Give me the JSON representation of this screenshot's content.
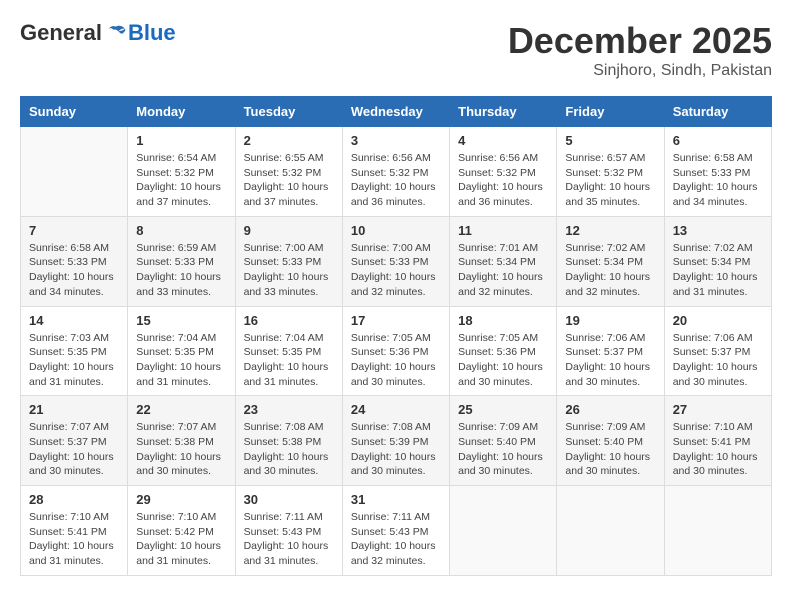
{
  "logo": {
    "general": "General",
    "blue": "Blue"
  },
  "header": {
    "month": "December 2025",
    "location": "Sinjhoro, Sindh, Pakistan"
  },
  "weekdays": [
    "Sunday",
    "Monday",
    "Tuesday",
    "Wednesday",
    "Thursday",
    "Friday",
    "Saturday"
  ],
  "weeks": [
    [
      {
        "day": "",
        "info": ""
      },
      {
        "day": "1",
        "info": "Sunrise: 6:54 AM\nSunset: 5:32 PM\nDaylight: 10 hours\nand 37 minutes."
      },
      {
        "day": "2",
        "info": "Sunrise: 6:55 AM\nSunset: 5:32 PM\nDaylight: 10 hours\nand 37 minutes."
      },
      {
        "day": "3",
        "info": "Sunrise: 6:56 AM\nSunset: 5:32 PM\nDaylight: 10 hours\nand 36 minutes."
      },
      {
        "day": "4",
        "info": "Sunrise: 6:56 AM\nSunset: 5:32 PM\nDaylight: 10 hours\nand 36 minutes."
      },
      {
        "day": "5",
        "info": "Sunrise: 6:57 AM\nSunset: 5:32 PM\nDaylight: 10 hours\nand 35 minutes."
      },
      {
        "day": "6",
        "info": "Sunrise: 6:58 AM\nSunset: 5:33 PM\nDaylight: 10 hours\nand 34 minutes."
      }
    ],
    [
      {
        "day": "7",
        "info": "Sunrise: 6:58 AM\nSunset: 5:33 PM\nDaylight: 10 hours\nand 34 minutes."
      },
      {
        "day": "8",
        "info": "Sunrise: 6:59 AM\nSunset: 5:33 PM\nDaylight: 10 hours\nand 33 minutes."
      },
      {
        "day": "9",
        "info": "Sunrise: 7:00 AM\nSunset: 5:33 PM\nDaylight: 10 hours\nand 33 minutes."
      },
      {
        "day": "10",
        "info": "Sunrise: 7:00 AM\nSunset: 5:33 PM\nDaylight: 10 hours\nand 32 minutes."
      },
      {
        "day": "11",
        "info": "Sunrise: 7:01 AM\nSunset: 5:34 PM\nDaylight: 10 hours\nand 32 minutes."
      },
      {
        "day": "12",
        "info": "Sunrise: 7:02 AM\nSunset: 5:34 PM\nDaylight: 10 hours\nand 32 minutes."
      },
      {
        "day": "13",
        "info": "Sunrise: 7:02 AM\nSunset: 5:34 PM\nDaylight: 10 hours\nand 31 minutes."
      }
    ],
    [
      {
        "day": "14",
        "info": "Sunrise: 7:03 AM\nSunset: 5:35 PM\nDaylight: 10 hours\nand 31 minutes."
      },
      {
        "day": "15",
        "info": "Sunrise: 7:04 AM\nSunset: 5:35 PM\nDaylight: 10 hours\nand 31 minutes."
      },
      {
        "day": "16",
        "info": "Sunrise: 7:04 AM\nSunset: 5:35 PM\nDaylight: 10 hours\nand 31 minutes."
      },
      {
        "day": "17",
        "info": "Sunrise: 7:05 AM\nSunset: 5:36 PM\nDaylight: 10 hours\nand 30 minutes."
      },
      {
        "day": "18",
        "info": "Sunrise: 7:05 AM\nSunset: 5:36 PM\nDaylight: 10 hours\nand 30 minutes."
      },
      {
        "day": "19",
        "info": "Sunrise: 7:06 AM\nSunset: 5:37 PM\nDaylight: 10 hours\nand 30 minutes."
      },
      {
        "day": "20",
        "info": "Sunrise: 7:06 AM\nSunset: 5:37 PM\nDaylight: 10 hours\nand 30 minutes."
      }
    ],
    [
      {
        "day": "21",
        "info": "Sunrise: 7:07 AM\nSunset: 5:37 PM\nDaylight: 10 hours\nand 30 minutes."
      },
      {
        "day": "22",
        "info": "Sunrise: 7:07 AM\nSunset: 5:38 PM\nDaylight: 10 hours\nand 30 minutes."
      },
      {
        "day": "23",
        "info": "Sunrise: 7:08 AM\nSunset: 5:38 PM\nDaylight: 10 hours\nand 30 minutes."
      },
      {
        "day": "24",
        "info": "Sunrise: 7:08 AM\nSunset: 5:39 PM\nDaylight: 10 hours\nand 30 minutes."
      },
      {
        "day": "25",
        "info": "Sunrise: 7:09 AM\nSunset: 5:40 PM\nDaylight: 10 hours\nand 30 minutes."
      },
      {
        "day": "26",
        "info": "Sunrise: 7:09 AM\nSunset: 5:40 PM\nDaylight: 10 hours\nand 30 minutes."
      },
      {
        "day": "27",
        "info": "Sunrise: 7:10 AM\nSunset: 5:41 PM\nDaylight: 10 hours\nand 30 minutes."
      }
    ],
    [
      {
        "day": "28",
        "info": "Sunrise: 7:10 AM\nSunset: 5:41 PM\nDaylight: 10 hours\nand 31 minutes."
      },
      {
        "day": "29",
        "info": "Sunrise: 7:10 AM\nSunset: 5:42 PM\nDaylight: 10 hours\nand 31 minutes."
      },
      {
        "day": "30",
        "info": "Sunrise: 7:11 AM\nSunset: 5:43 PM\nDaylight: 10 hours\nand 31 minutes."
      },
      {
        "day": "31",
        "info": "Sunrise: 7:11 AM\nSunset: 5:43 PM\nDaylight: 10 hours\nand 32 minutes."
      },
      {
        "day": "",
        "info": ""
      },
      {
        "day": "",
        "info": ""
      },
      {
        "day": "",
        "info": ""
      }
    ]
  ]
}
